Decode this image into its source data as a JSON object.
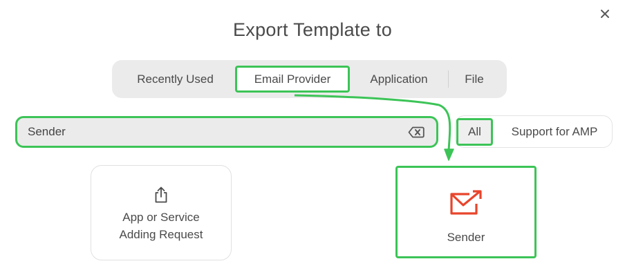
{
  "dialog": {
    "title": "Export Template to",
    "close_icon": "close-icon"
  },
  "tabs": [
    {
      "label": "Recently Used",
      "selected": false
    },
    {
      "label": "Email Provider",
      "selected": true
    },
    {
      "label": "Application",
      "selected": false
    },
    {
      "label": "File",
      "selected": false
    }
  ],
  "search": {
    "value": "Sender",
    "clear_icon": "clear-input-icon"
  },
  "filters": [
    {
      "label": "All",
      "selected": true
    },
    {
      "label": "Support for AMP",
      "selected": false
    }
  ],
  "results": [
    {
      "label": "App or Service\nAdding Request",
      "icon": "share-upload-icon"
    },
    {
      "label": "Sender",
      "icon": "sender-mail-icon"
    }
  ],
  "colors": {
    "highlight": "#3cc457",
    "sender_brand": "#e8452c",
    "tab_bar_bg": "#ebebeb"
  }
}
